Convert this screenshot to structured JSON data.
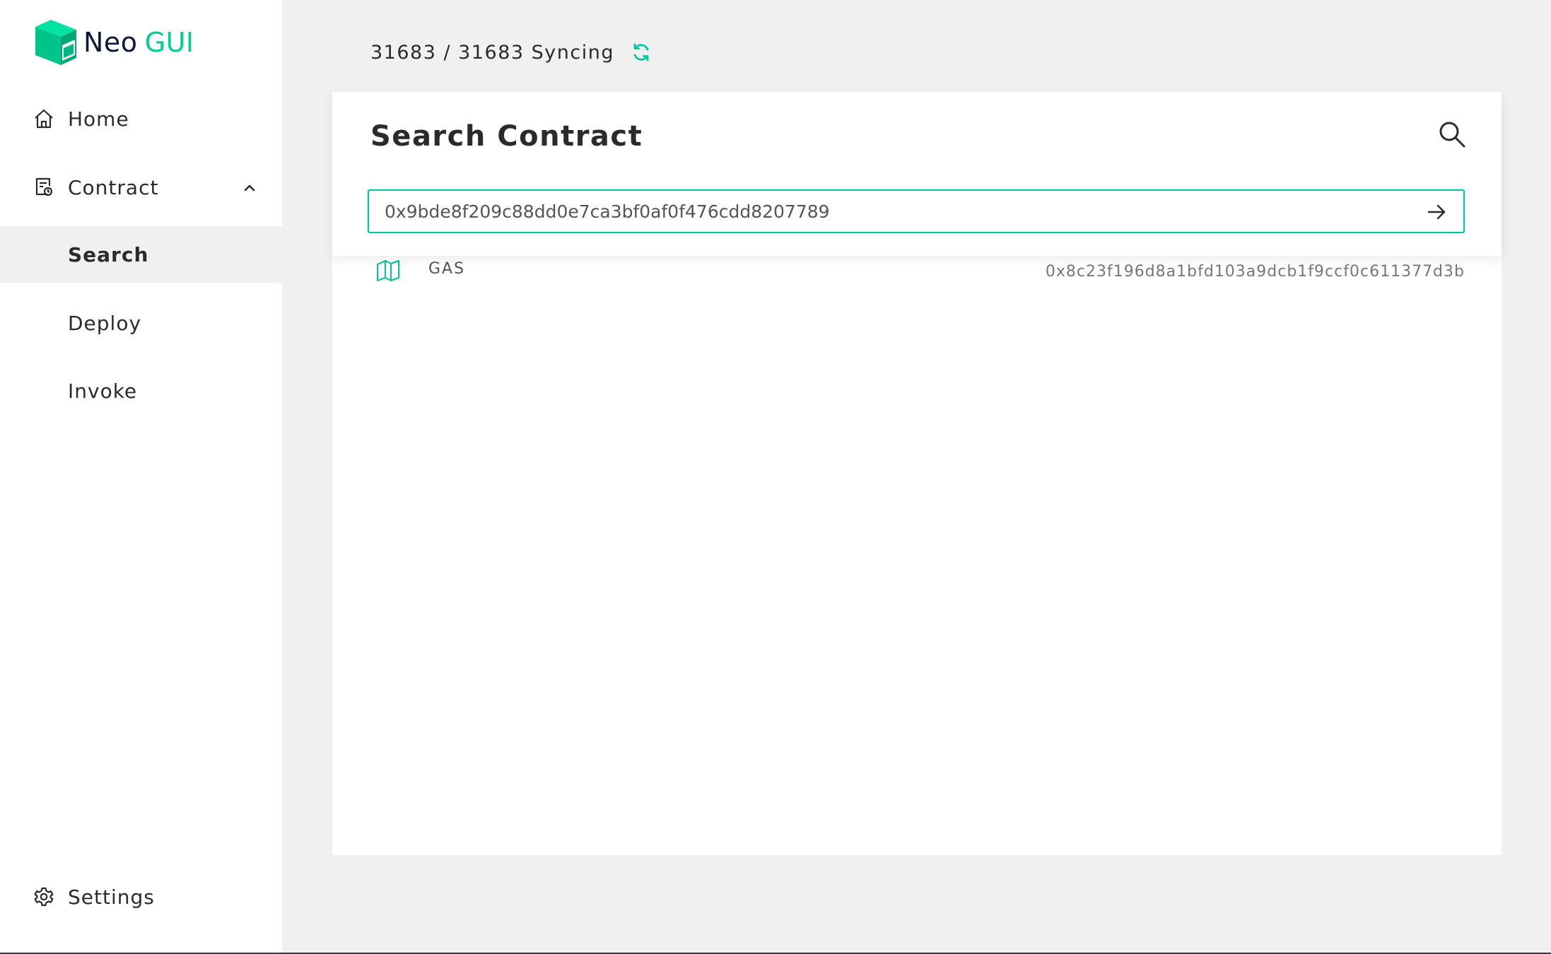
{
  "app": {
    "logo_neo": "Neo",
    "logo_gui": "GUI",
    "brand_color": "#00cf92"
  },
  "sidebar": {
    "items": [
      {
        "label": "Home",
        "icon": "home-icon"
      },
      {
        "label": "Contract",
        "icon": "contract-icon",
        "expanded": true
      },
      {
        "label": "Search",
        "active": true
      },
      {
        "label": "Deploy"
      },
      {
        "label": "Invoke"
      }
    ],
    "settings": {
      "label": "Settings",
      "icon": "gear-icon"
    }
  },
  "status": {
    "sync_text": "31683 / 31683 Syncing",
    "icon": "sync-icon"
  },
  "search": {
    "title": "Search Contract",
    "input_value": "0x9bde8f209c88dd0e7ca3bf0af0f476cdd8207789",
    "search_icon": "search-icon",
    "submit_icon": "arrow-right-icon",
    "accent_color": "#00c69a"
  },
  "results": [
    {
      "name": "GAS",
      "hash": "0x8c23f196d8a1bfd103a9dcb1f9ccf0c611377d3b",
      "icon": "contract-map-icon"
    }
  ]
}
